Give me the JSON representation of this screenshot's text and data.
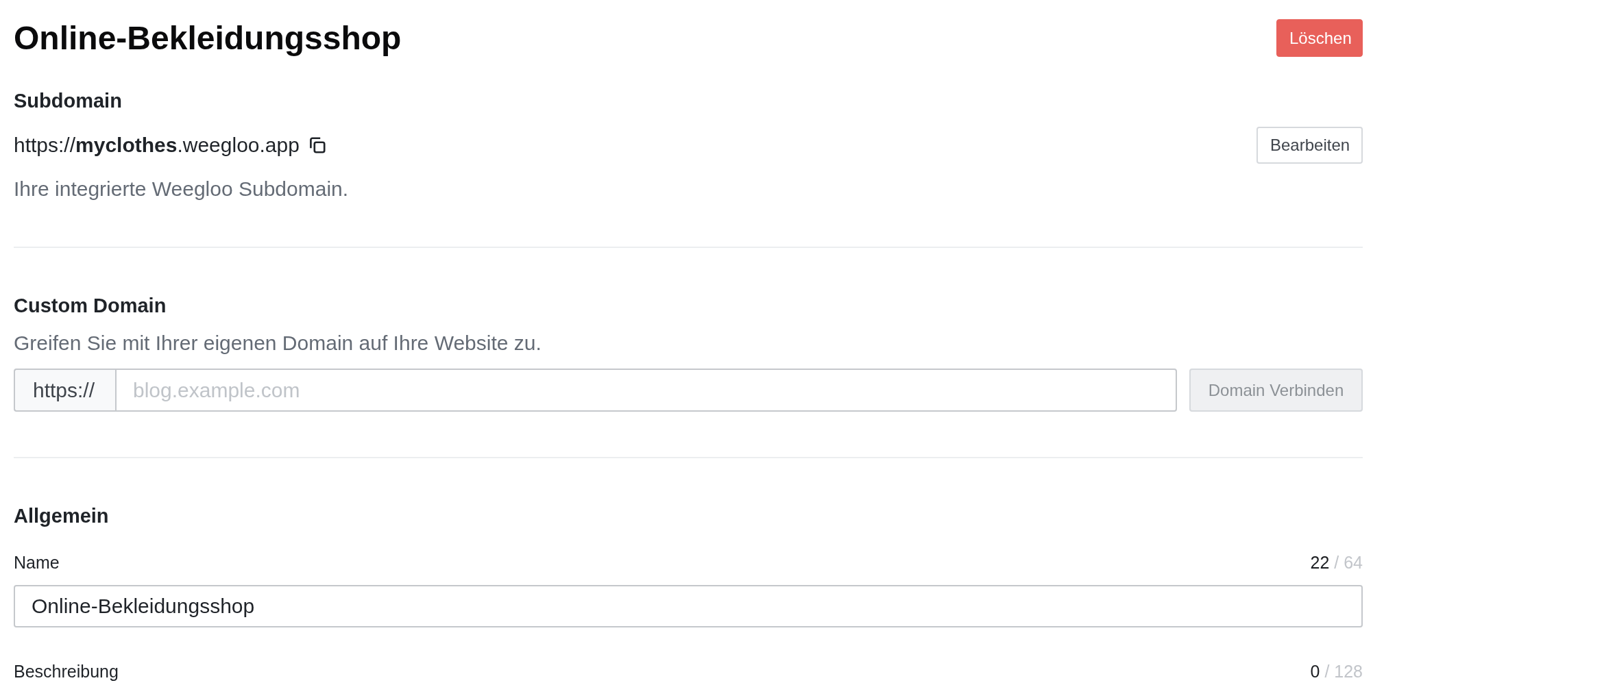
{
  "header": {
    "title": "Online-Bekleidungsshop",
    "delete_button": "Löschen"
  },
  "subdomain": {
    "heading": "Subdomain",
    "url": "https://**myclothes**.weegloo.app",
    "edit_button": "Bearbeiten",
    "description": "Ihre integrierte Weegloo Subdomain."
  },
  "custom_domain": {
    "heading": "Custom Domain",
    "description": "Greifen Sie mit Ihrer eigenen Domain auf Ihre Website zu.",
    "prefix": "https://",
    "domain_field": {
      "placeholder": "blog.example.com"
    },
    "connect_button": {
      "label": "Domain Verbinden",
      "disabled": true
    }
  },
  "general": {
    "heading": "Allgemein",
    "fields": [
      {
        "label": "Name",
        "count": "22",
        "limit": "/ 64",
        "value": "Online-Bekleidungsshop"
      },
      {
        "label": "Beschreibung",
        "count": "0",
        "limit": "/ 128"
      }
    ]
  }
}
